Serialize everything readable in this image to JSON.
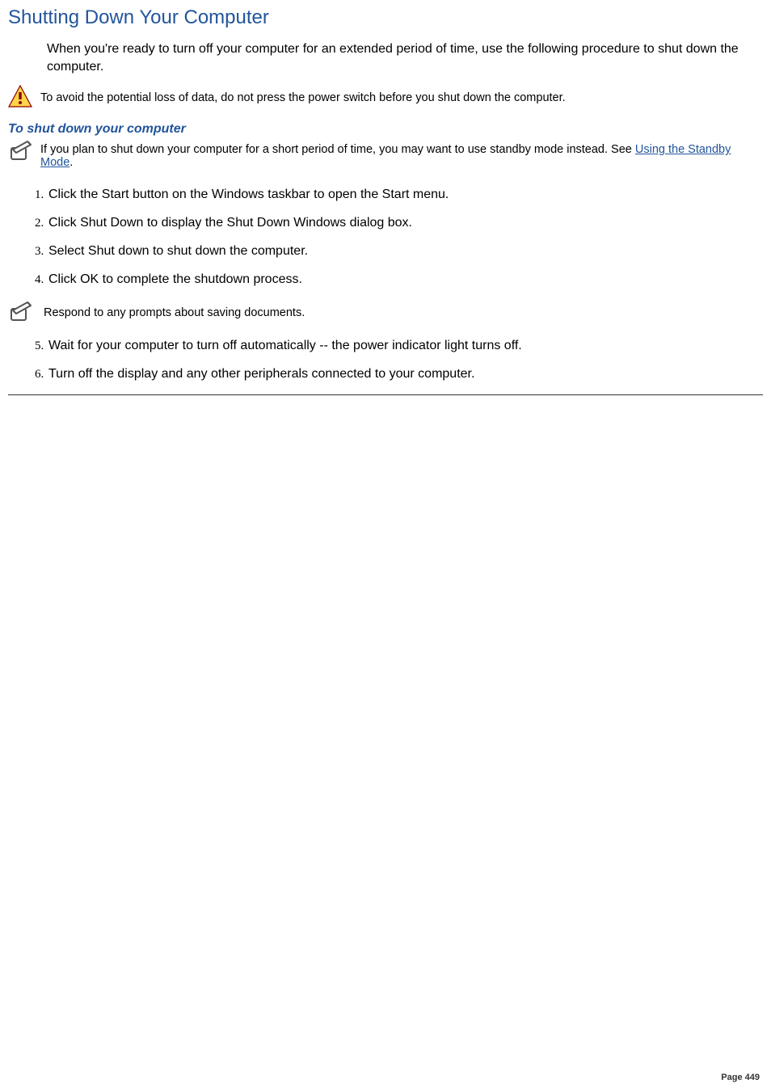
{
  "heading": "Shutting Down Your Computer",
  "intro": "When you're ready to turn off your computer for an extended period of time, use the following procedure to shut down the computer.",
  "warning_text": "To avoid the potential loss of data, do not press the power switch before you shut down the computer.",
  "subhead": "To shut down your computer",
  "tip_text_pre": "If you plan to shut down your computer for a short period of time, you may want to use standby mode instead. See ",
  "tip_link": "Using the Standby Mode",
  "steps_a": [
    "Click the Start button on the Windows taskbar to open the Start menu.",
    "Click Shut Down to display the Shut Down Windows dialog box.",
    "Select Shut down to shut down the computer.",
    "Click OK to complete the shutdown process."
  ],
  "mid_note": "Respond to any prompts about saving documents.",
  "steps_b": [
    "Wait for your computer to turn off automatically -- the power indicator light turns off.",
    "Turn off the display and any other peripherals connected to your computer."
  ],
  "page_label": "Page 449"
}
